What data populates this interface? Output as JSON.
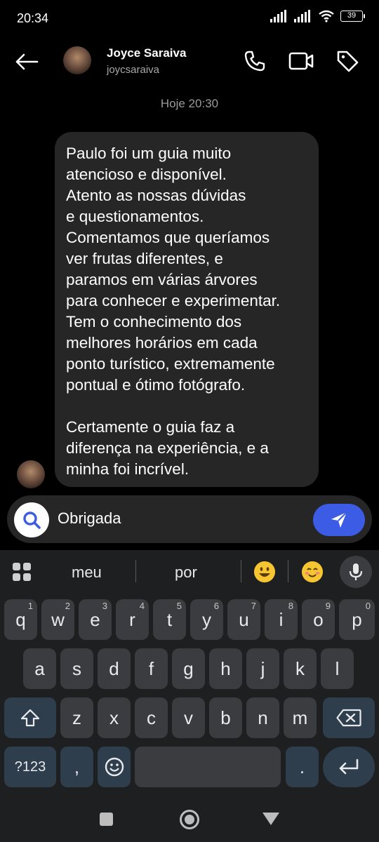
{
  "status_bar": {
    "time": "20:34",
    "battery": "39"
  },
  "header": {
    "contact_name": "Joyce Saraiva",
    "contact_handle": "joycsaraiva",
    "icons": [
      "back-arrow-icon",
      "phone-icon",
      "video-icon",
      "tag-icon"
    ]
  },
  "conversation": {
    "timestamp": "Hoje 20:30",
    "message": "Paulo foi um guia muito\natencioso e disponível.\nAtento as nossas dúvidas\ne questionamentos.\nComentamos que queríamos\nver frutas diferentes, e\nparamos em várias árvores\npara conhecer e experimentar.\nTem o conhecimento dos\nmelhores horários em cada\nponto turístico, extremamente\npontual e ótimo fotógrafo.\n\nCertamente o guia faz a\ndiferença na experiência, e a\nminha foi incrível."
  },
  "composer": {
    "value": "Obrigada"
  },
  "keyboard": {
    "suggestions": [
      "meu",
      "por"
    ],
    "emoji_suggestions": [
      "grinning-face",
      "smiling-face"
    ],
    "row1": [
      {
        "k": "q",
        "n": "1"
      },
      {
        "k": "w",
        "n": "2"
      },
      {
        "k": "e",
        "n": "3"
      },
      {
        "k": "r",
        "n": "4"
      },
      {
        "k": "t",
        "n": "5"
      },
      {
        "k": "y",
        "n": "6"
      },
      {
        "k": "u",
        "n": "7"
      },
      {
        "k": "i",
        "n": "8"
      },
      {
        "k": "o",
        "n": "9"
      },
      {
        "k": "p",
        "n": "0"
      }
    ],
    "row2": [
      "a",
      "s",
      "d",
      "f",
      "g",
      "h",
      "j",
      "k",
      "l"
    ],
    "row3": [
      "z",
      "x",
      "c",
      "v",
      "b",
      "n",
      "m"
    ],
    "symbols_label": "?123",
    "comma": ",",
    "period": "."
  },
  "colors": {
    "send_button": "#3d5ce6",
    "bubble": "#262626",
    "keyboard_bg": "#1e1f21",
    "key": "#3a3c40"
  }
}
